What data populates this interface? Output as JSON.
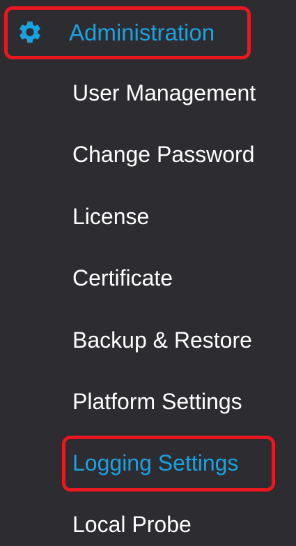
{
  "colors": {
    "background": "#2d2c31",
    "text": "#ffffff",
    "accent": "#1aa2e0",
    "highlight": "#e8181e"
  },
  "menu": {
    "header": {
      "icon": "gear-icon",
      "label": "Administration"
    },
    "items": [
      {
        "label": "User Management",
        "active": false
      },
      {
        "label": "Change Password",
        "active": false
      },
      {
        "label": "License",
        "active": false
      },
      {
        "label": "Certificate",
        "active": false
      },
      {
        "label": "Backup & Restore",
        "active": false
      },
      {
        "label": "Platform Settings",
        "active": false
      },
      {
        "label": "Logging Settings",
        "active": true
      },
      {
        "label": "Local Probe",
        "active": false
      }
    ]
  }
}
